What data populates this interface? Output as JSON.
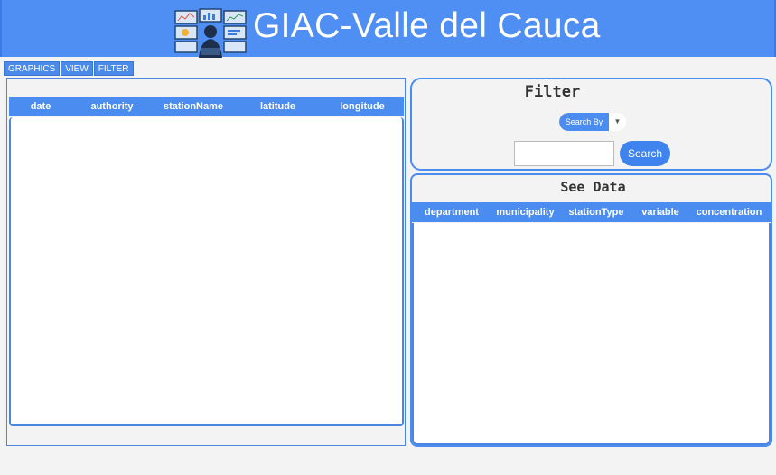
{
  "app": {
    "title": "GIAC-Valle del Cauca"
  },
  "tabs": [
    {
      "label": "GRAPHICS"
    },
    {
      "label": "VIEW"
    },
    {
      "label": "FILTER"
    }
  ],
  "main_table": {
    "columns": [
      "date",
      "authority",
      "stationName",
      "latitude",
      "longitude"
    ],
    "rows": []
  },
  "filter": {
    "title": "Filter",
    "select_label": "Search By",
    "search_value": "",
    "search_button": "Search"
  },
  "see_data": {
    "title": "See Data",
    "columns": [
      "department",
      "municipality",
      "stationType",
      "variable",
      "concentration"
    ],
    "rows": []
  },
  "colors": {
    "accent": "#4b8cf0",
    "background": "#f3f3f3"
  }
}
